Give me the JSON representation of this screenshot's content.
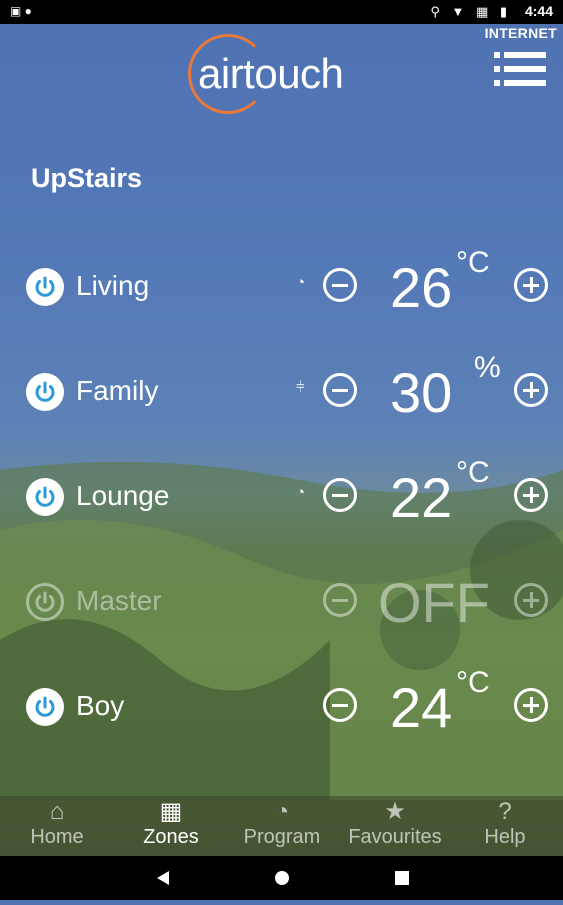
{
  "status_bar": {
    "time": "4:44",
    "network_label": "INTERNET"
  },
  "app": {
    "logo_text": "airtouch"
  },
  "group_title": "UpStairs",
  "zones": [
    {
      "name": "Living",
      "value": "26",
      "unit": "°C",
      "mode_icon": "clock-icon",
      "on": true
    },
    {
      "name": "Family",
      "value": "30",
      "unit": "%",
      "mode_icon": "sensor-icon",
      "on": true
    },
    {
      "name": "Lounge",
      "value": "22",
      "unit": "°C",
      "mode_icon": "clock-icon",
      "on": true
    },
    {
      "name": "Master",
      "value": "OFF",
      "unit": "",
      "mode_icon": "",
      "on": false
    },
    {
      "name": "Boy",
      "value": "24",
      "unit": "°C",
      "mode_icon": "",
      "on": true
    }
  ],
  "tabs": [
    {
      "label": "Home",
      "icon": "home-icon"
    },
    {
      "label": "Zones",
      "icon": "zones-icon",
      "active": true
    },
    {
      "label": "Program",
      "icon": "clock-icon"
    },
    {
      "label": "Favourites",
      "icon": "star-icon"
    },
    {
      "label": "Help",
      "icon": "help-icon"
    }
  ],
  "colors": {
    "accent": "#e8793a",
    "power_icon": "#2a9ad8"
  }
}
